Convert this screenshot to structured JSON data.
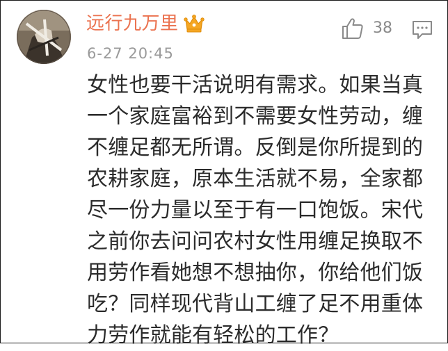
{
  "comment": {
    "username": "远行九万里",
    "badge_icon": "crown-icon",
    "timestamp": "6-27 20:45",
    "like_icon": "thumbs-up-icon",
    "like_count": "38",
    "reply_icon": "comment-icon",
    "text": "女性也要干活说明有需求。如果当真一个家庭富裕到不需要女性劳动，缠不缠足都无所谓。反倒是你所提到的农耕家庭，原本生活就不易，全家都尽一份力量以至于有一口饱饭。宋代之前你去问问农村女性用缠足换取不用劳作看她想不想抽你，你给他们饭吃？同样现代背山工缠了足不用重体力劳作就能有轻松的工作？"
  },
  "colors": {
    "username": "#eb7350",
    "crown": "#f5a623",
    "timestamp": "#9a9a9a",
    "body_text": "#2b2b2b",
    "icons": "#8a8a8a"
  }
}
